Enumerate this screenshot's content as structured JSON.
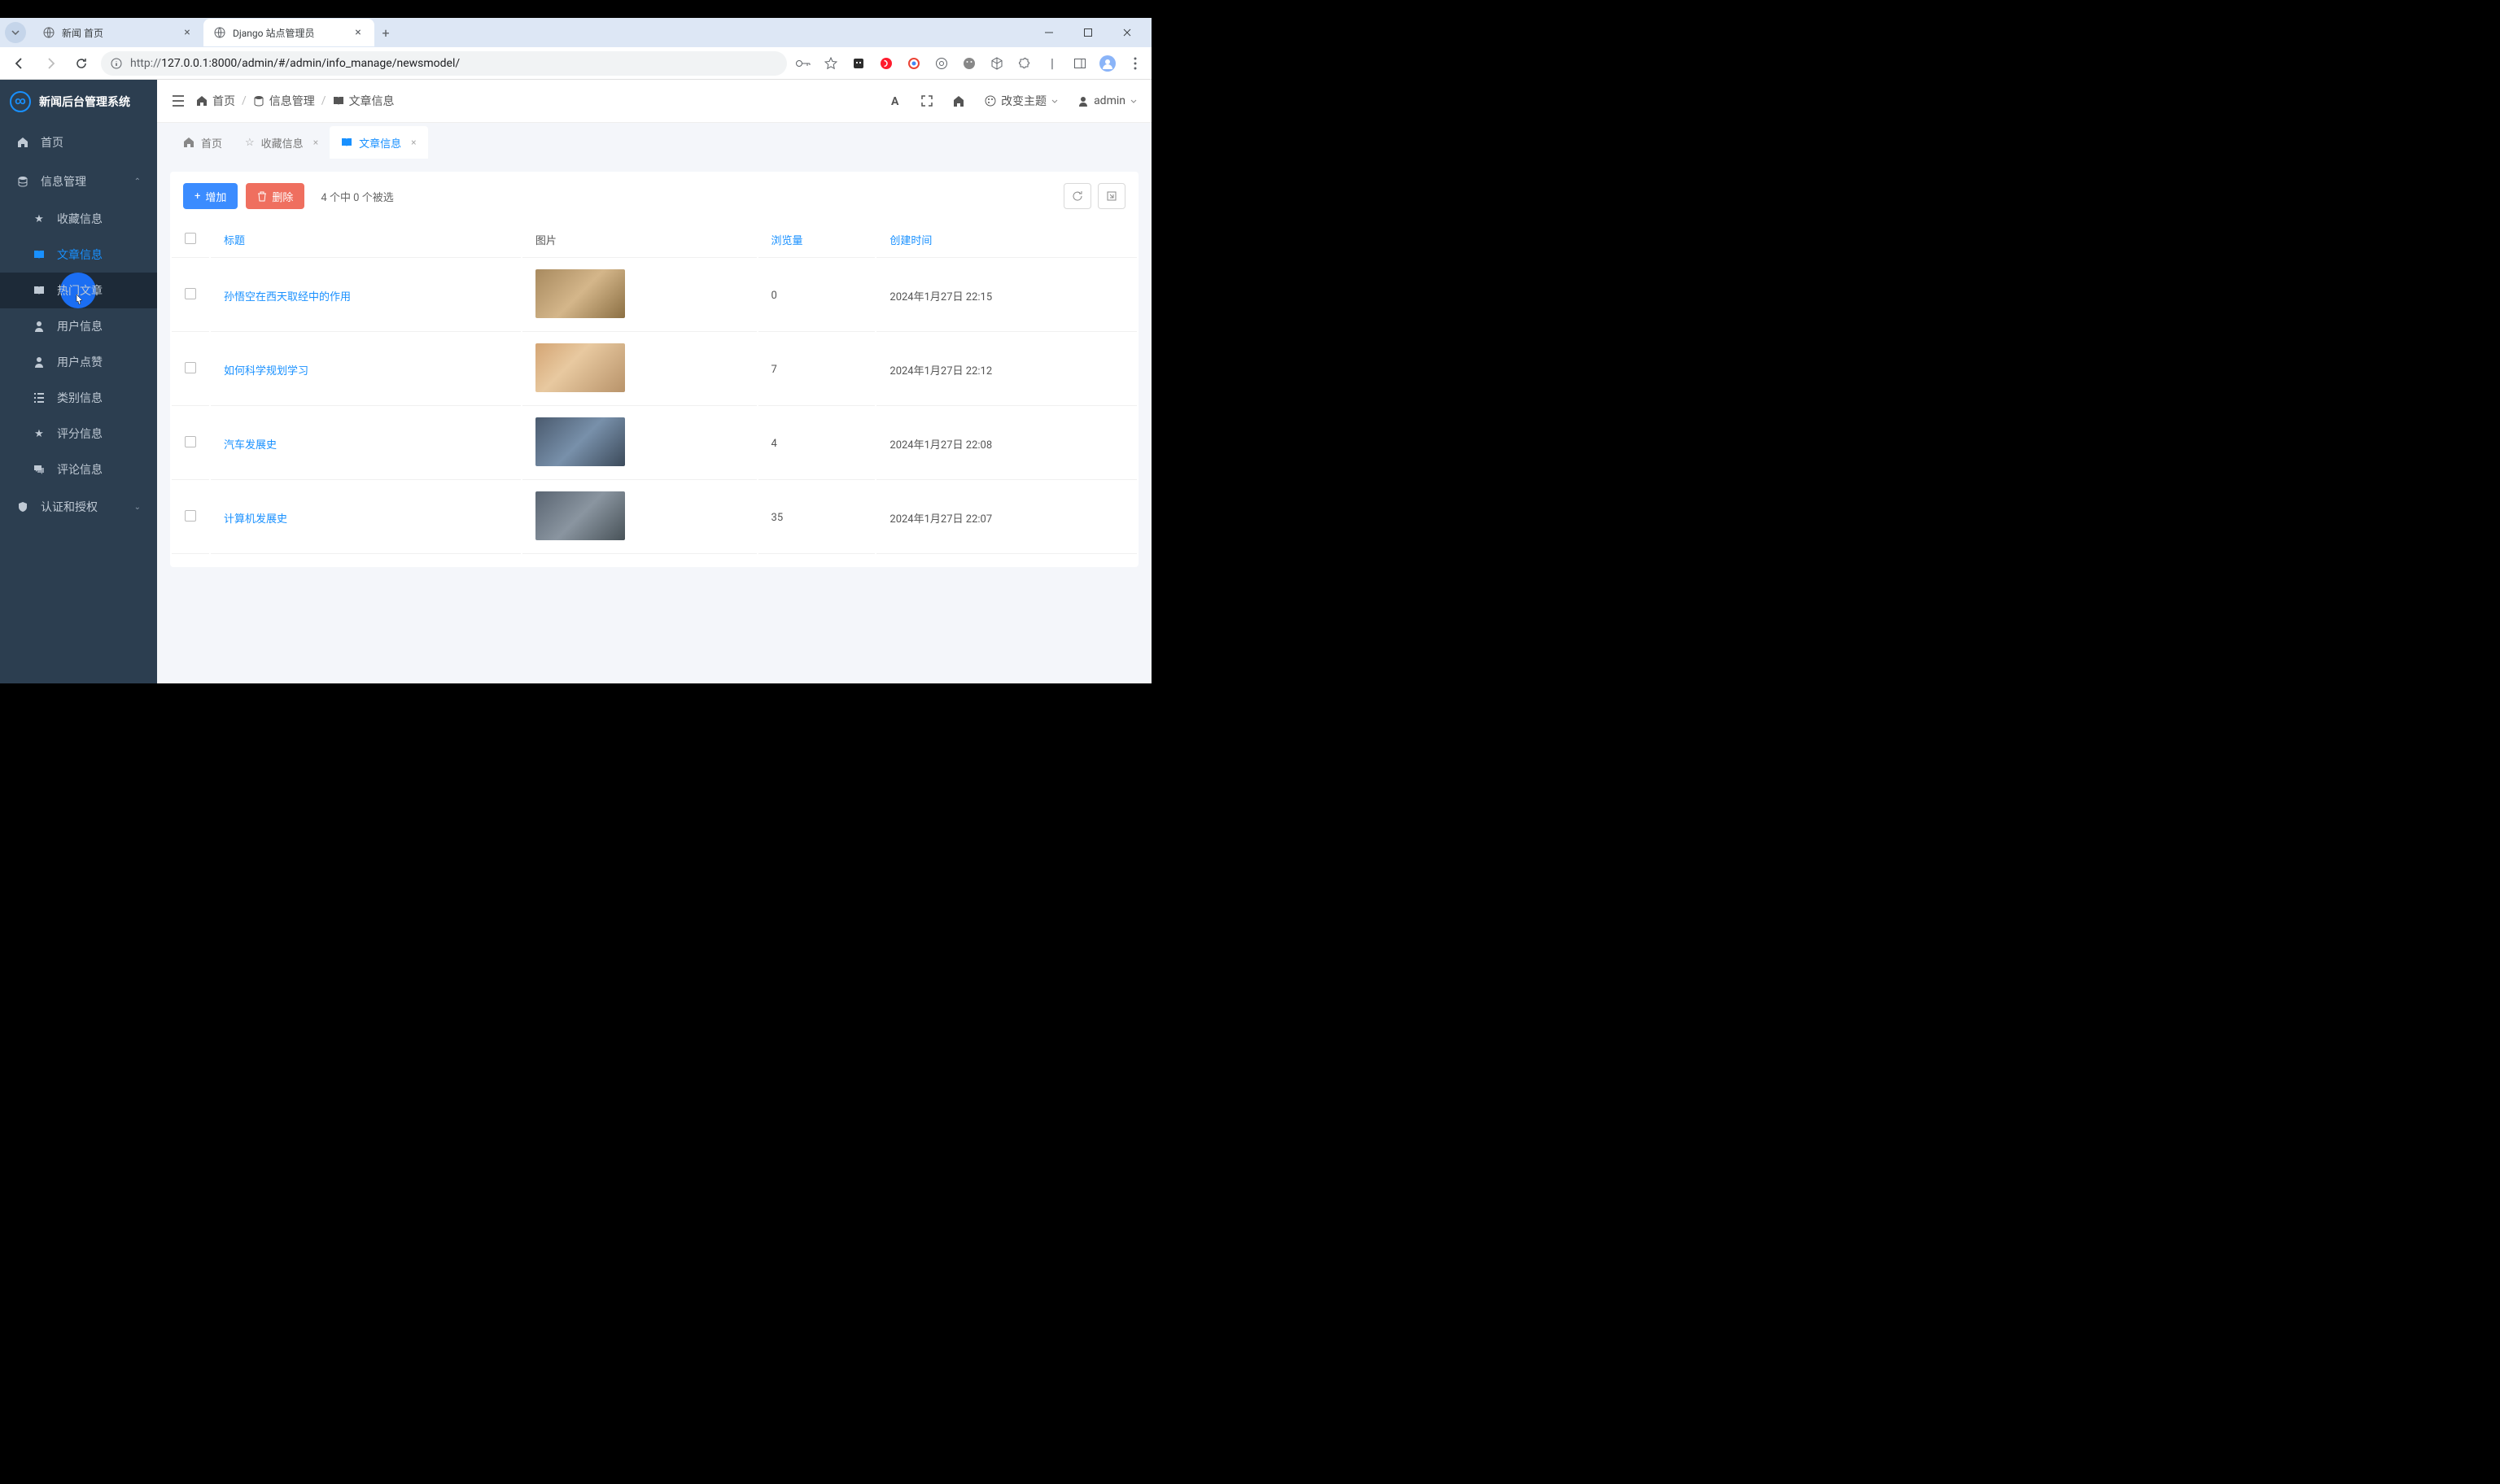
{
  "browser": {
    "tabs": [
      {
        "label": "新闻 首页",
        "active": false
      },
      {
        "label": "Django 站点管理员",
        "active": true
      }
    ],
    "url": "http://127.0.0.1:8000/admin/#/admin/info_manage/newsmodel/",
    "url_scheme": "http://",
    "url_rest": "127.0.0.1:8000/admin/#/admin/info_manage/newsmodel/"
  },
  "sidebar": {
    "title": "新闻后台管理系统",
    "items": [
      {
        "label": "首页",
        "icon": "home"
      },
      {
        "label": "信息管理",
        "icon": "db",
        "expanded": true,
        "children": [
          {
            "label": "收藏信息",
            "icon": "star"
          },
          {
            "label": "文章信息",
            "icon": "book",
            "active": true
          },
          {
            "label": "热门文章",
            "icon": "book",
            "hovered": true
          },
          {
            "label": "用户信息",
            "icon": "user"
          },
          {
            "label": "用户点赞",
            "icon": "user"
          },
          {
            "label": "类别信息",
            "icon": "list"
          },
          {
            "label": "评分信息",
            "icon": "star"
          },
          {
            "label": "评论信息",
            "icon": "comments"
          }
        ]
      },
      {
        "label": "认证和授权",
        "icon": "shield",
        "expanded": false
      }
    ]
  },
  "topbar": {
    "breadcrumb": [
      {
        "label": "首页",
        "icon": "home"
      },
      {
        "label": "信息管理",
        "icon": "db"
      },
      {
        "label": "文章信息",
        "icon": "book"
      }
    ],
    "theme_label": "改变主题",
    "user_label": "admin"
  },
  "tabs": [
    {
      "label": "首页",
      "icon": "home",
      "closable": false
    },
    {
      "label": "收藏信息",
      "icon": "star",
      "closable": true
    },
    {
      "label": "文章信息",
      "icon": "book",
      "closable": true,
      "active": true
    }
  ],
  "toolbar": {
    "add_label": "增加",
    "delete_label": "删除",
    "selection_text": "4 个中 0 个被选"
  },
  "table": {
    "headers": {
      "title": "标题",
      "image": "图片",
      "views": "浏览量",
      "created": "创建时间"
    },
    "rows": [
      {
        "title": "孙悟空在西天取经中的作用",
        "views": "0",
        "created": "2024年1月27日 22:15",
        "thumb": "thumb1"
      },
      {
        "title": "如何科学规划学习",
        "views": "7",
        "created": "2024年1月27日 22:12",
        "thumb": "thumb2"
      },
      {
        "title": "汽车发展史",
        "views": "4",
        "created": "2024年1月27日 22:08",
        "thumb": "thumb3"
      },
      {
        "title": "计算机发展史",
        "views": "35",
        "created": "2024年1月27日 22:07",
        "thumb": "thumb4"
      }
    ]
  }
}
